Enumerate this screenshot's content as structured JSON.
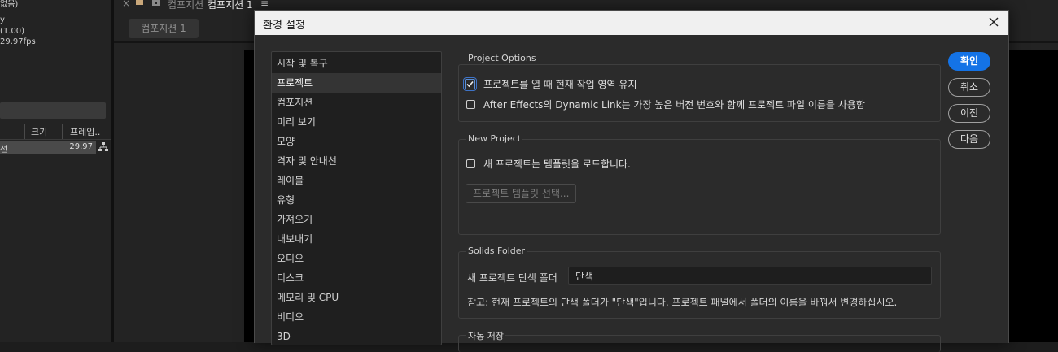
{
  "background_app": {
    "left_panel": {
      "line1": "없음)",
      "line2": "y",
      "line3": "(1.00)",
      "line4": "29.97fps",
      "col_size": "크기",
      "col_frame": "프레임..",
      "row_name": "선",
      "row_value": "29.97"
    },
    "tabbar": {
      "close": "×",
      "comp_label_dim": "컴포지션",
      "comp_label_active": "컴포지션 1",
      "menu": "≡"
    },
    "comp_subtab": "컴포지션 1"
  },
  "dialog": {
    "title": "환경 설정",
    "categories": [
      "시작 및 복구",
      "프로젝트",
      "컴포지션",
      "미리 보기",
      "모양",
      "격자 및 안내선",
      "레이블",
      "유형",
      "가져오기",
      "내보내기",
      "오디오",
      "디스크",
      "메모리 및 CPU",
      "비디오",
      "3D"
    ],
    "selected_category": "프로젝트",
    "project_options": {
      "title": "Project Options",
      "opt1": "프로젝트를 열 때 현재 작업 영역 유지",
      "opt1_checked": true,
      "opt2": "After Effects의 Dynamic Link는 가장 높은 버전 번호와 함께 프로젝트 파일 이름을 사용함",
      "opt2_checked": false
    },
    "new_project": {
      "title": "New Project",
      "opt": "새 프로젝트는 템플릿을 로드합니다.",
      "opt_checked": false,
      "template_button": "프로젝트 템플릿 선택..."
    },
    "solids_folder": {
      "title": "Solids Folder",
      "label": "새 프로젝트 단색 폴더",
      "value": "단색",
      "note": "참고: 현재 프로젝트의 단색 폴더가 \"단색\"입니다. 프로젝트 패널에서 폴더의 이름을 바꿔서 변경하십시오."
    },
    "autosave": {
      "title": "자동 저장"
    },
    "buttons": {
      "ok": "확인",
      "cancel": "취소",
      "previous": "이전",
      "next": "다음"
    },
    "accent_color": "#1473e6"
  }
}
